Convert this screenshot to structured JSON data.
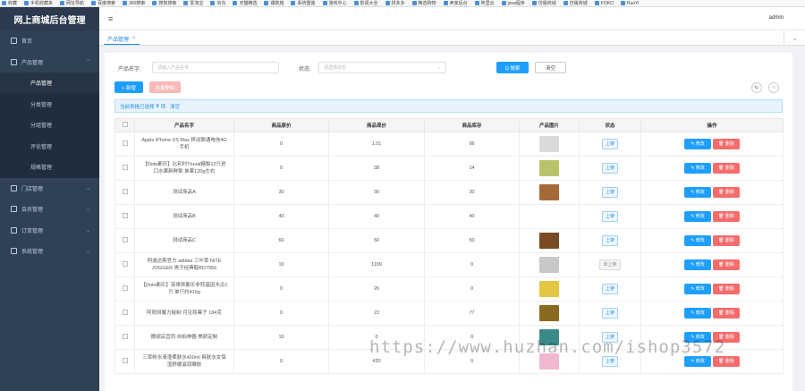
{
  "bookmarks": [
    "收藏",
    "手机收藏夹",
    "网址导航",
    "百度搜索",
    "360搜索",
    "搜狗搜索",
    "爱淘宝",
    "京东",
    "天猫精选",
    "爆款趋",
    "系统重装",
    "游戏中心",
    "影视大全",
    "拼多多",
    "精选购物",
    "卖家后台",
    "阿里云",
    "java程序",
    "仿版商城",
    "仿版商城",
    "FOKO",
    "RuoYi"
  ],
  "sidebar": {
    "logo": "网上商城后台管理",
    "items": [
      {
        "label": "首页"
      },
      {
        "label": "产品管理"
      },
      {
        "label": "产品管理"
      },
      {
        "label": "分类管理"
      },
      {
        "label": "分组管理"
      },
      {
        "label": "评论管理"
      },
      {
        "label": "规格管理"
      },
      {
        "label": "门店管理"
      },
      {
        "label": "会员管理"
      },
      {
        "label": "订单管理"
      },
      {
        "label": "系统管理"
      }
    ]
  },
  "header": {
    "menu_icon": "≡",
    "user": "admin"
  },
  "tabs": {
    "active": "产品管理",
    "close": "×",
    "dropdown": "⌄"
  },
  "search": {
    "name_label": "产品名字:",
    "name_placeholder": "请输入产品名字",
    "status_label": "状态:",
    "status_placeholder": "请选择状态",
    "search_btn": "Q 搜索",
    "clear_btn": "清空"
  },
  "toolbar": {
    "add_btn": "+ 新增",
    "batch_delete_btn": "批量删除"
  },
  "selection": {
    "prefix": "当前表格已选择",
    "count": "0",
    "suffix": "项",
    "clear": "清空"
  },
  "table": {
    "headers": [
      "产品名字",
      "商品原价",
      "商品现价",
      "商品库存",
      "产品图片",
      "状态",
      "操作"
    ],
    "edit_label": "修改",
    "delete_label": "删除",
    "rows": [
      {
        "name": "Apple iPhone XS Max 移动联通电信4G手机",
        "orig": "0",
        "price": "1.01",
        "stock": "96",
        "status": "上架",
        "img": "#dadada"
      },
      {
        "name": "【Dole都乐】比利时Truval糖梨12只进口水果新鲜梨 单果120g左右",
        "orig": "0",
        "price": "38",
        "stock": "14",
        "status": "上架",
        "img": "#b9c46a"
      },
      {
        "name": "测试商品A",
        "orig": "30",
        "price": "30",
        "stock": "30",
        "status": "上架",
        "img": "#a56a3a"
      },
      {
        "name": "测试商品B",
        "orig": "40",
        "price": "40",
        "stock": "40",
        "status": "上架",
        "img": "#ffffff"
      },
      {
        "name": "测试商品C",
        "orig": "60",
        "price": "50",
        "stock": "50",
        "status": "上架",
        "img": "#7a4a24"
      },
      {
        "name": "阿迪达斯官方 adidas 三叶草 NITE JOGGER 男子经典鞋BD7956",
        "orig": "10",
        "price": "1199",
        "stock": "0",
        "status": "未上架",
        "img": "#c8c8c8"
      },
      {
        "name": "【Dole都乐】菲律宾都乐非转基因木瓜1只 单只约410g",
        "orig": "0",
        "price": "26",
        "stock": "0",
        "status": "上架",
        "img": "#e5c642"
      },
      {
        "name": "阿阳饼馨力秘制 月见和菓子 184克",
        "orig": "0",
        "price": "22",
        "stock": "77",
        "status": "上架",
        "img": "#8a6a1e"
      },
      {
        "name": "撒砚店宜同 自拍神器 美颜定制",
        "orig": "10",
        "price": "0",
        "stock": "0",
        "status": "上架",
        "img": "#3a8a8a"
      },
      {
        "name": "三草粉水清澄柔肤水400ml 爽肤水女保湿舒缓滋润嫩肤",
        "orig": "0",
        "price": "420",
        "stock": "0",
        "status": "上架",
        "img": "#f0b8d0"
      }
    ]
  },
  "watermark": "https://www.huzhan.com/ishop3572"
}
